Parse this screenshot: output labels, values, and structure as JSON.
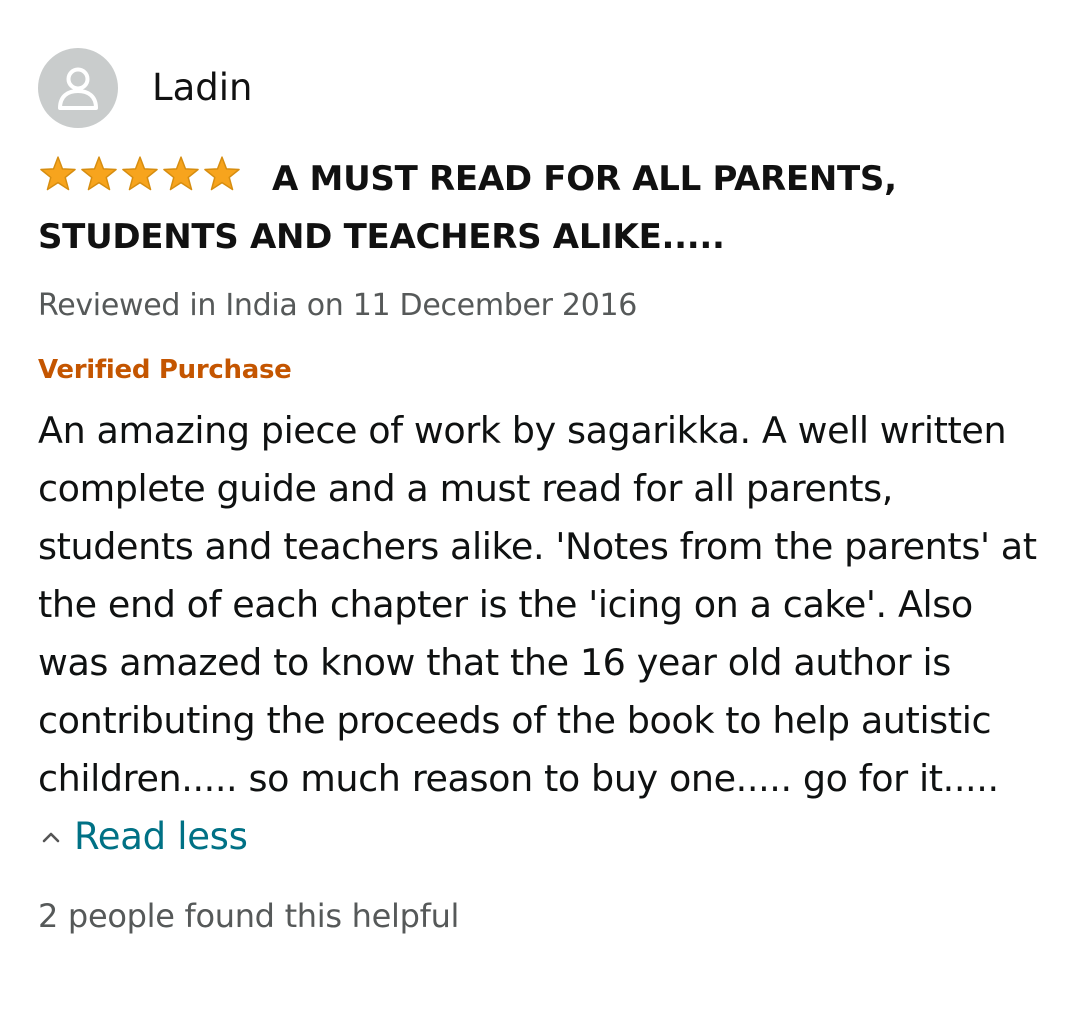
{
  "review": {
    "profile": {
      "name": "Ladin",
      "avatar_icon": "user-silhouette-icon"
    },
    "rating": {
      "stars": 5,
      "max_stars": 5,
      "star_color": "#f7a41d"
    },
    "title": "A MUST READ FOR ALL PARENTS, STUDENTS AND TEACHERS ALIKE.....",
    "reviewed_line": "Reviewed in India on 11 December 2016",
    "verified_label": "Verified Purchase",
    "body": "An amazing piece of work by sagarikka. A well written complete guide and a must read for all parents, students and teachers alike. 'Notes from the parents' at the end of each chapter is the 'icing on a cake'. Also was amazed to know that the 16 year old author is contributing the proceeds of the book to help autistic children..... so much reason to buy one..... go for it.....",
    "read_less_label": "Read less",
    "helpful_text": "2 people found this helpful"
  },
  "colors": {
    "verified": "#c45500",
    "link": "#007185",
    "secondary_text": "#565959",
    "avatar_bg": "#c9cccc"
  }
}
